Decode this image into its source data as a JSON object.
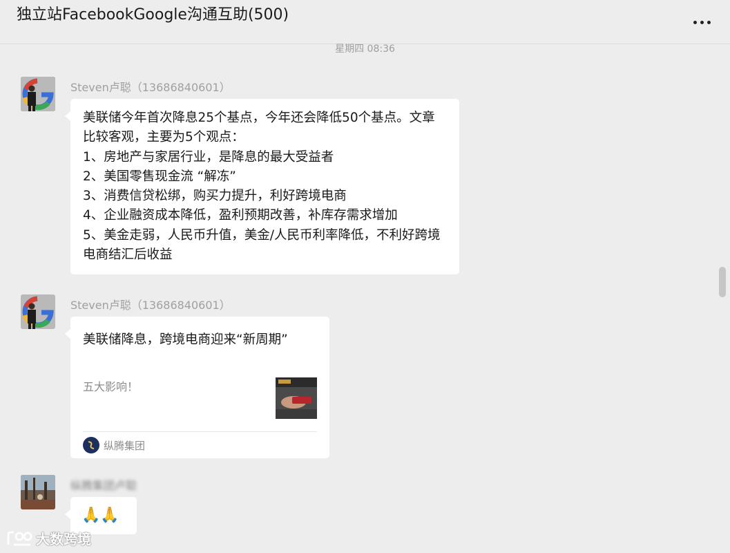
{
  "header": {
    "title": "独立站FacebookGoogle沟通互助(500)",
    "more_icon": "more-horizontal-icon"
  },
  "timestamp": "星期四 08:36",
  "messages": [
    {
      "sender": "Steven卢聪（13686840601）",
      "text": "美联储今年首次降息25个基点，今年还会降低50个基点。文章比较客观，主要为5个观点：\n1、房地产与家居行业，是降息的最大受益者\n2、美国零售现金流 “解冻”\n3、消费信贷松绑，购买力提升，利好跨境电商\n4、企业融资成本降低，盈利预期改善，补库存需求增加\n5、美金走弱，人民币升值，美金/人民币利率降低，不利好跨境电商结汇后收益"
    },
    {
      "sender": "Steven卢聪（13686840601）",
      "card": {
        "title": "美联储降息，跨境电商迎来“新周期”",
        "description": "五大影响！",
        "source": "纵腾集团"
      }
    },
    {
      "sender": "",
      "emoji": "🙏🙏"
    }
  ],
  "watermark": {
    "text": "大数跨境"
  },
  "colors": {
    "background": "#ededed",
    "bubble": "#ffffff",
    "sender": "#a0a0a0"
  }
}
